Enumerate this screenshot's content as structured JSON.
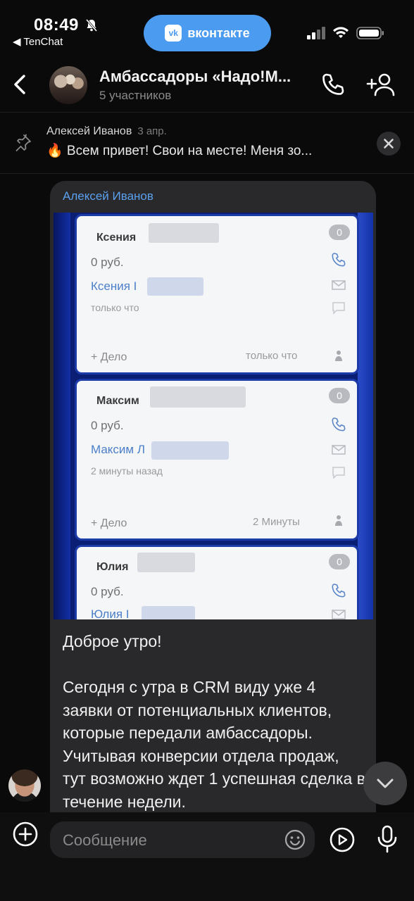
{
  "status_bar": {
    "time": "08:49",
    "back_app": "◀ TenChat",
    "vk_label": "вконтакте",
    "vk_logo": "vk"
  },
  "header": {
    "title": "Амбассадоры «Надо!М...",
    "subtitle": "5 участников"
  },
  "pinned": {
    "author": "Алексей Иванов",
    "date": "3 апр.",
    "text": "🔥 Всем привет! Свои на месте! Меня зо..."
  },
  "message": {
    "author": "Алексей Иванов",
    "text": "Доброе утро!\n\nСегодня с утра в CRM виду уже 4 заявки от потенциальных клиентов, которые передали амбассадоры. Учитывая конверсии отдела продаж, тут возможно ждет 1 успешная сделка в течение недели.",
    "photo_cards": [
      {
        "name": "Ксения",
        "amount": "0 руб.",
        "contact": "Ксения І",
        "time": "только что",
        "add": "+ Дело",
        "right_time": "только что",
        "count": "0"
      },
      {
        "name": "Максим",
        "amount": "0 руб.",
        "contact": "Максим Л",
        "time": "2 минуты назад",
        "add": "+ Дело",
        "right_time": "2 Минуты",
        "count": "0"
      },
      {
        "name": "Юлия",
        "amount": "0 руб.",
        "contact": "Юлия І",
        "count": "0"
      }
    ]
  },
  "composer": {
    "placeholder": "Сообщение"
  },
  "colors": {
    "accent": "#4b9bf0",
    "author": "#5aa0ee",
    "bubble": "#29292b",
    "background": "#0a0a0a"
  }
}
